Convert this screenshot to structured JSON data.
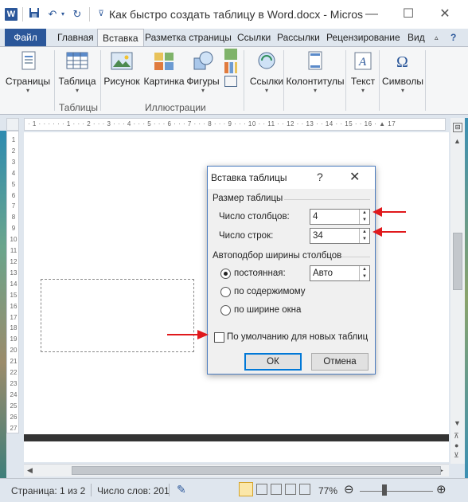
{
  "window": {
    "title": "Как быстро создать таблицу в Word.docx - Micros",
    "logo_letter": "W"
  },
  "tabs": [
    {
      "label": "Файл"
    },
    {
      "label": "Главная"
    },
    {
      "label": "Вставка"
    },
    {
      "label": "Разметка страницы"
    },
    {
      "label": "Ссылки"
    },
    {
      "label": "Рассылки"
    },
    {
      "label": "Рецензирование"
    },
    {
      "label": "Вид"
    }
  ],
  "ribbon": {
    "buttons": [
      {
        "label": "Страницы",
        "icon": "pages-icon"
      },
      {
        "label": "Таблица",
        "icon": "table-icon"
      },
      {
        "label": "Рисунок",
        "icon": "picture-icon"
      },
      {
        "label": "Картинка",
        "icon": "clipart-icon"
      },
      {
        "label": "Фигуры",
        "icon": "shapes-icon"
      },
      {
        "label": "Ссылки",
        "icon": "links-icon"
      },
      {
        "label": "Колонтитулы",
        "icon": "header-footer-icon"
      },
      {
        "label": "Текст",
        "icon": "text-icon"
      },
      {
        "label": "Символы",
        "icon": "symbols-icon"
      }
    ],
    "groups": {
      "tables": "Таблицы",
      "illustrations": "Иллюстрации"
    }
  },
  "ruler": {
    "h_marks": "· 1 · · · · · · 1 · · · 2 · · · 3 · · · 4 · · · 5 · · · 6 · · · 7 · · · 8 · · · 9 · · · 10 · · 11 · · 12 · · 13 · · 14 · · 15 · · 16 · ▲ 17",
    "v_marks": [
      "1",
      "2",
      "3",
      "4",
      "5",
      "6",
      "7",
      "8",
      "9",
      "10",
      "11",
      "12",
      "13",
      "14",
      "15",
      "16",
      "17",
      "18",
      "19",
      "20",
      "21",
      "22",
      "23",
      "24",
      "25",
      "26",
      "27"
    ]
  },
  "dialog": {
    "title": "Вставка таблицы",
    "help": "?",
    "close": "✕",
    "size_section": "Размер таблицы",
    "columns_label": "Число столбцов:",
    "columns_value": "4",
    "rows_label": "Число строк:",
    "rows_value": "34",
    "autofit_section": "Автоподбор ширины столбцов",
    "fixed_label": "постоянная:",
    "fixed_value": "Авто",
    "content_label": "по содержимому",
    "window_label": "по ширине окна",
    "default_label": "По умолчанию для новых таблиц",
    "ok": "ОК",
    "cancel": "Отмена"
  },
  "status": {
    "page": "Страница: 1 из 2",
    "words": "Число слов: 201",
    "zoom": "77%"
  },
  "colors": {
    "brand": "#2b579a",
    "arrow": "#e0191c"
  }
}
